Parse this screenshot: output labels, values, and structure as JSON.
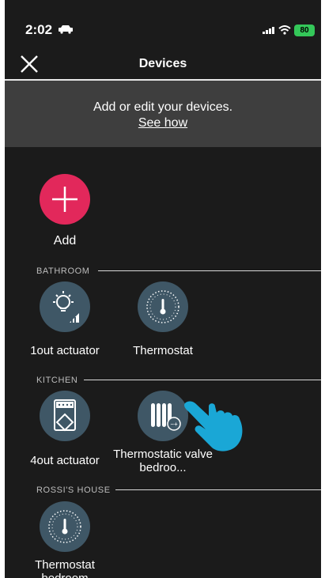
{
  "status_bar": {
    "time": "2:02",
    "battery": "80"
  },
  "header": {
    "title": "Devices"
  },
  "banner": {
    "text": "Add or edit your devices.",
    "link": "See how"
  },
  "add": {
    "label": "Add"
  },
  "sections": [
    {
      "title": "BATHROOM",
      "devices": [
        {
          "label": "1out actuator",
          "icon": "light-actuator-icon"
        },
        {
          "label": "Thermostat",
          "icon": "thermostat-icon"
        }
      ]
    },
    {
      "title": "KITCHEN",
      "devices": [
        {
          "label": "4out actuator",
          "icon": "multi-output-actuator-icon"
        },
        {
          "label": "Thermostatic valve bedroo...",
          "icon": "radiator-valve-icon"
        }
      ]
    },
    {
      "title": "ROSSI'S HOUSE",
      "devices": [
        {
          "label": "Thermostat bedroom",
          "icon": "thermostat-icon"
        }
      ]
    }
  ],
  "colors": {
    "background": "#1b1b1b",
    "banner": "#3e3e3e",
    "add_button": "#e2285b",
    "device_icon_bg": "#3f5766",
    "hand_pointer": "#1aa7d6",
    "battery": "#34c759"
  }
}
